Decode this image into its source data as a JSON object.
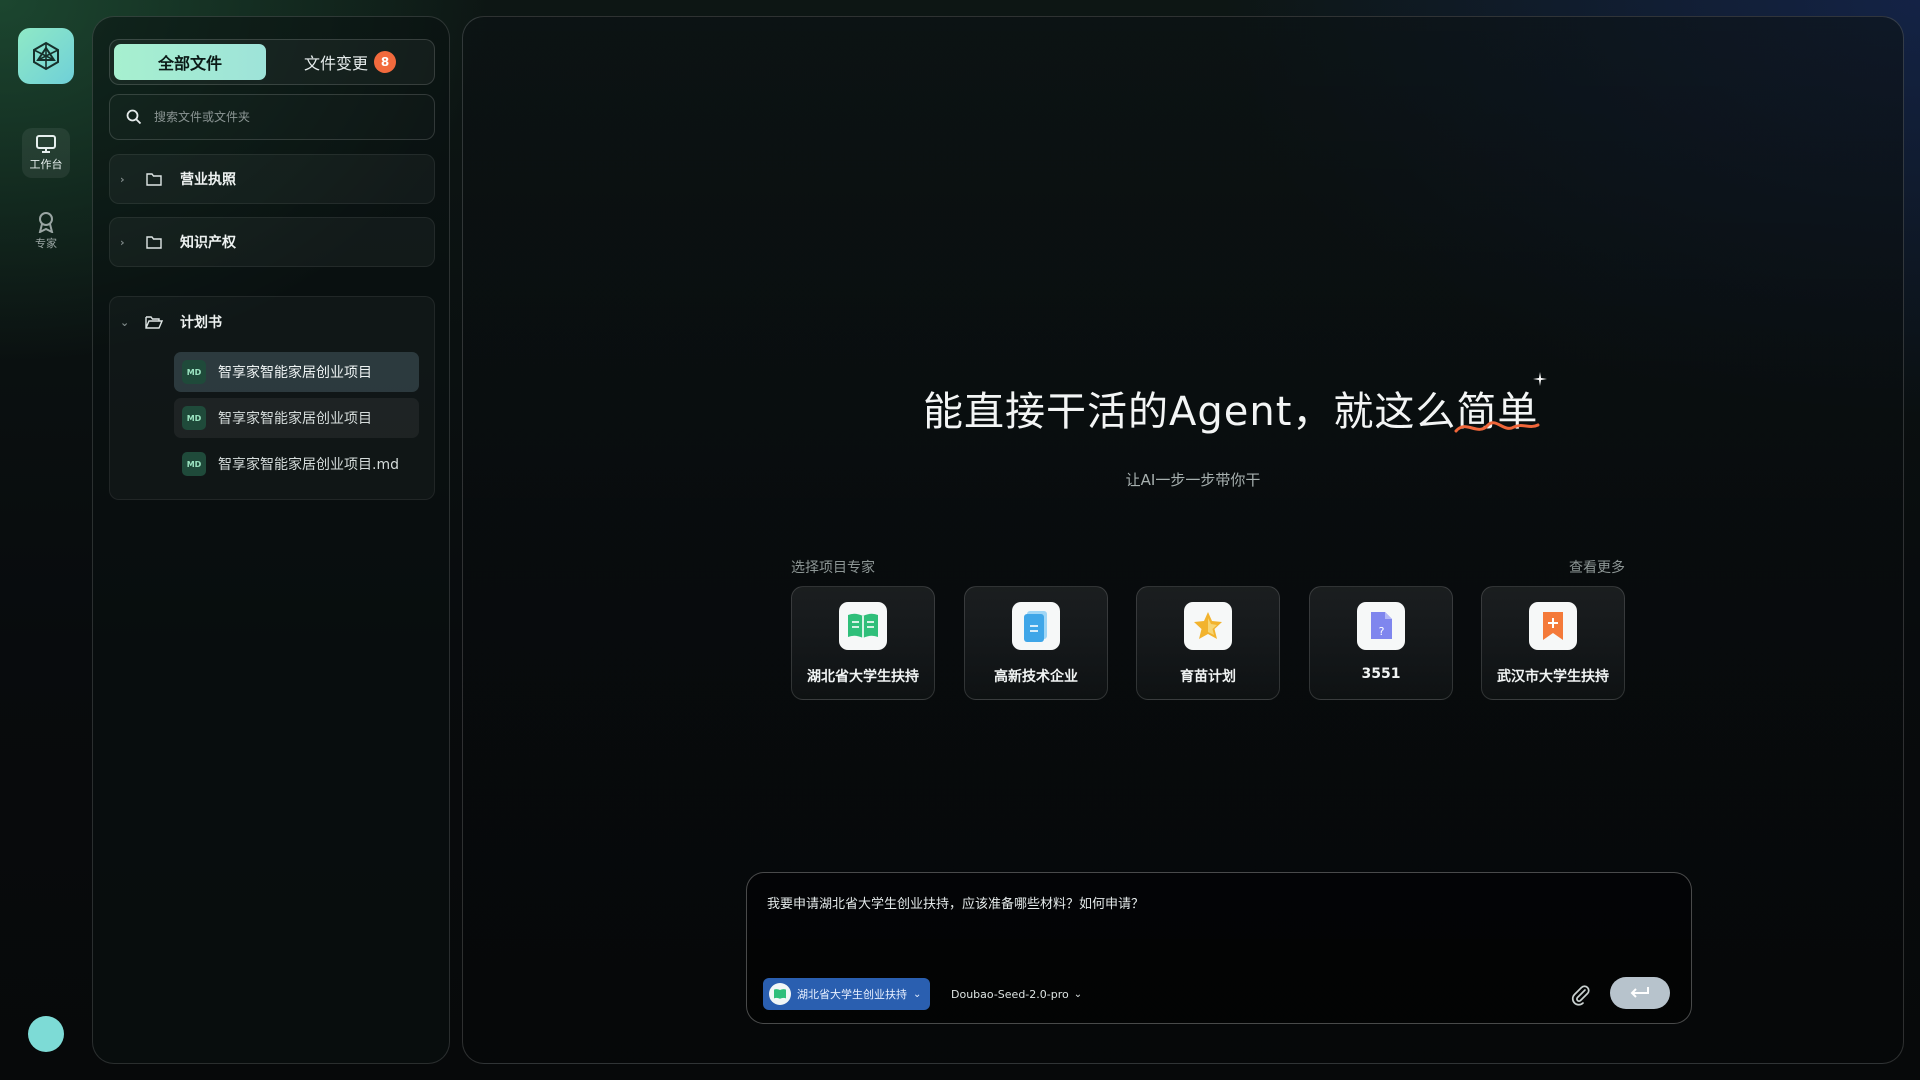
{
  "rail": {
    "items": [
      {
        "label": "工作台",
        "icon": "monitor-icon",
        "active": true
      },
      {
        "label": "专家",
        "icon": "award-icon",
        "active": false
      }
    ]
  },
  "files": {
    "tabs": [
      {
        "label": "全部文件",
        "active": true
      },
      {
        "label": "文件变更",
        "badge": "8"
      }
    ],
    "search_placeholder": "搜索文件或文件夹",
    "folders": [
      {
        "name": "营业执照",
        "expanded": false
      },
      {
        "name": "知识产权",
        "expanded": false
      },
      {
        "name": "计划书",
        "expanded": true,
        "children": [
          {
            "badge": "MD",
            "name": "智享家智能家居创业项目"
          },
          {
            "badge": "MD",
            "name": "智享家智能家居创业项目"
          },
          {
            "badge": "MD",
            "name": "智享家智能家居创业项目.md"
          }
        ]
      }
    ]
  },
  "hero": {
    "title_main": "能直接干活的Agent，就这么",
    "title_accent": "简单",
    "subtitle": "让AI一步一步带你干"
  },
  "experts": {
    "label": "选择项目专家",
    "more": "查看更多",
    "cards": [
      {
        "label": "湖北省大学生扶持",
        "icon": "book-icon",
        "color": "#2fbf7a"
      },
      {
        "label": "高新技术企业",
        "icon": "document-icon",
        "color": "#3fa6e8"
      },
      {
        "label": "育苗计划",
        "icon": "star-icon",
        "color": "#f2b32e"
      },
      {
        "label": "3551",
        "icon": "question-doc-icon",
        "color": "#7f86ee"
      },
      {
        "label": "武汉市大学生扶持",
        "icon": "bookmark-plus-icon",
        "color": "#f47a3a"
      }
    ]
  },
  "composer": {
    "text": "我要申请湖北省大学生创业扶持，应该准备哪些材料？如何申请？",
    "expert_chip": "湖北省大学生创业扶持",
    "model": "Doubao-Seed-2.0-pro"
  },
  "colors": {
    "accent": "#a7f0cf",
    "badge": "#f26a3d",
    "chip": "#2a5fb0",
    "underline": "#f0663a"
  }
}
